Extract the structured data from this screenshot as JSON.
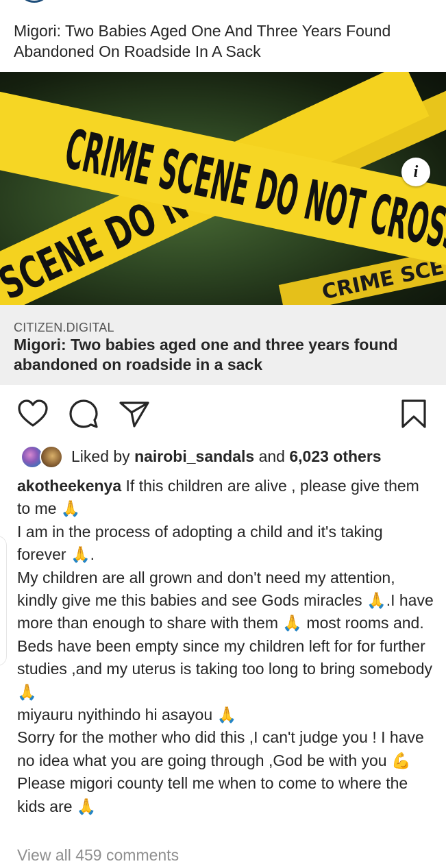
{
  "post": {
    "title": "Migori: Two Babies Aged One And Three Years Found Abandoned On Roadside In A Sack",
    "image_text": {
      "line1": "CRIME SCENE DO NOT CROSS",
      "line2": "SCENE DO NOT",
      "line3": "CRIME SCE"
    },
    "info_label": "i"
  },
  "link_card": {
    "domain": "CITIZEN.DIGITAL",
    "title": "Migori: Two babies aged one and three years found abandoned on roadside in a sack"
  },
  "actions": {
    "like": "heart-icon",
    "comment": "comment-icon",
    "share": "send-icon",
    "save": "bookmark-icon"
  },
  "likes": {
    "prefix": "Liked by ",
    "user": "nairobi_sandals",
    "middle": " and ",
    "others": "6,023 others"
  },
  "caption": {
    "username": "akotheekenya",
    "line1": " If this children are alive , please give them to me 🙏",
    "line2": "I am in the process of adopting a child and it's taking forever 🙏.",
    "line3": "My children are all grown and don't need my attention, kindly give me this babies and see Gods miracles 🙏.I have more than enough to share with them 🙏 most rooms and. Beds have been empty since my children  left for for further studies ,and my uterus is taking too long to bring somebody 🙏",
    "line4": "miyauru nyithindo hi asayou 🙏",
    "line5": "Sorry for the mother who did this ,I  can't judge you ! I have no idea what you are going through ,God be with you 💪",
    "line6": "Please migori county tell me when to come to where the kids are 🙏"
  },
  "comments": {
    "view_all": "View all 459 comments"
  },
  "colors": {
    "tape": "#f4d21f",
    "text": "#262626",
    "muted": "#8e8e8e",
    "card_bg": "#efefef"
  }
}
